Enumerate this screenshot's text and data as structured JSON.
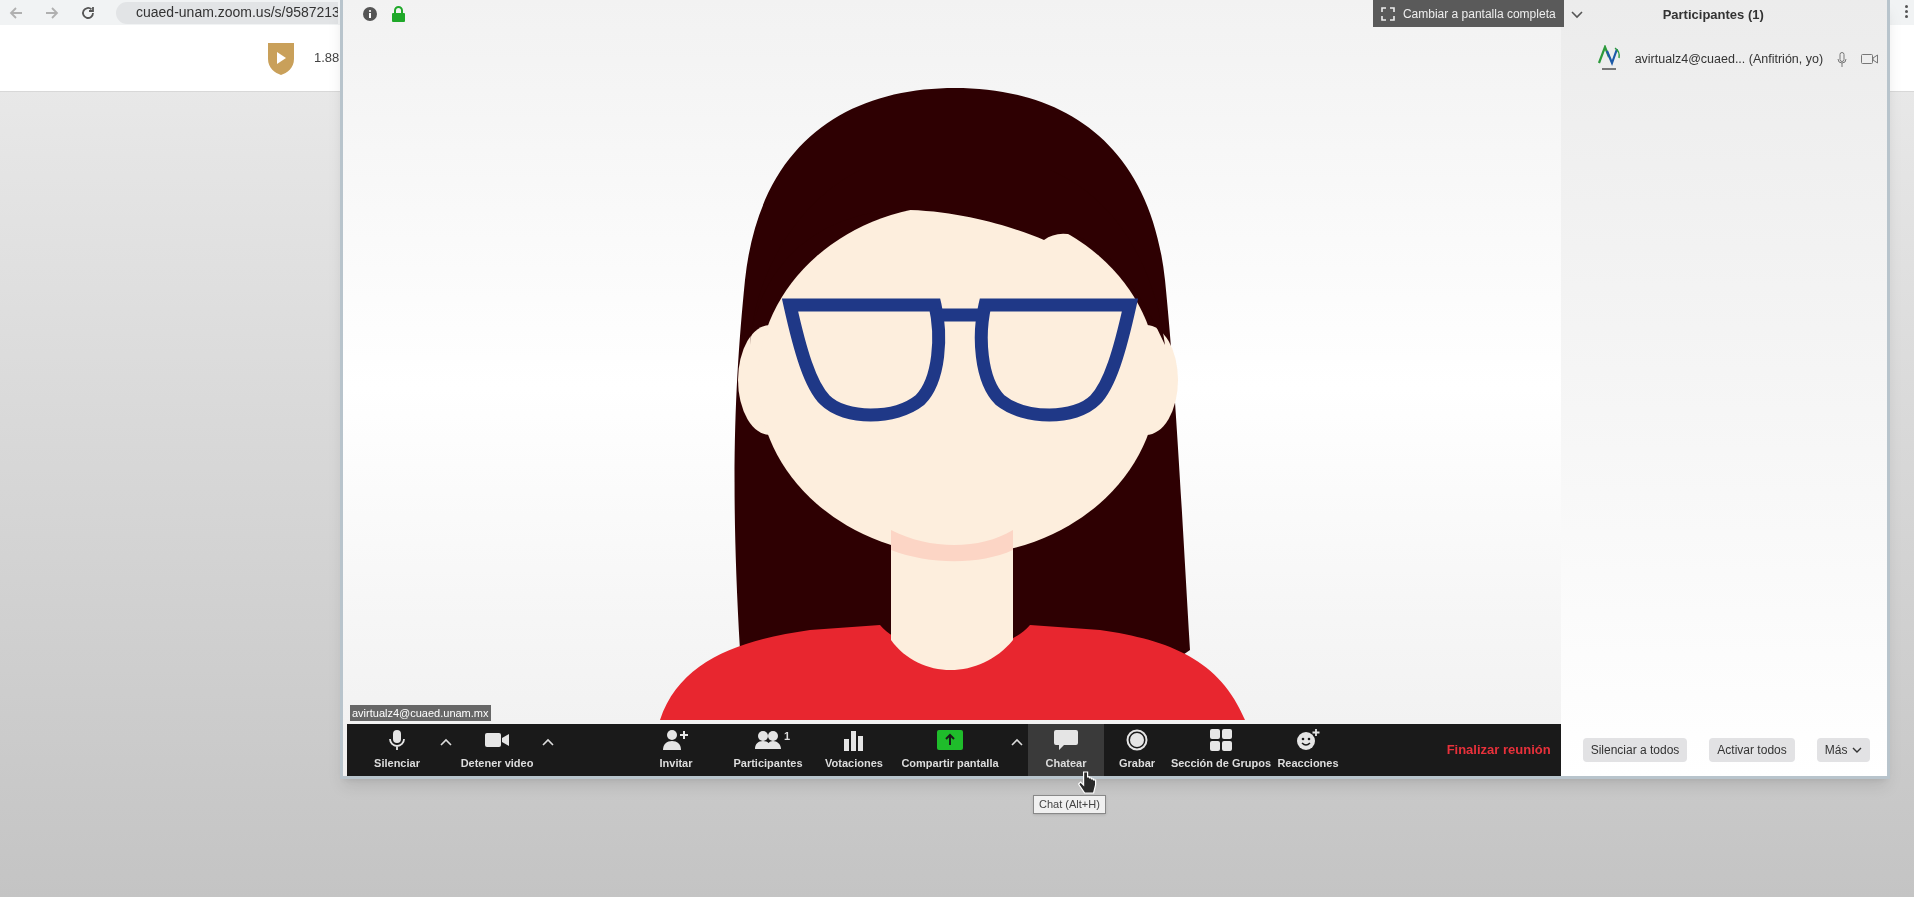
{
  "browser": {
    "url": "cuaed-unam.zoom.us/s/9587213",
    "page_text": "1.88"
  },
  "meeting": {
    "fullscreen_button": "Cambiar a pantalla completa",
    "name_label": "avirtualz4@cuaed.unam.mx",
    "toolbar": {
      "items": [
        {
          "kind": "mic",
          "label": "Silenciar",
          "caret": true,
          "hovered": false
        },
        {
          "kind": "video",
          "label": "Detener video",
          "caret": true,
          "hovered": false
        },
        {
          "kind": "invite",
          "label": "Invitar",
          "caret": false,
          "hovered": false
        },
        {
          "kind": "participants",
          "label": "Participantes",
          "badge": "1",
          "caret": false,
          "hovered": false
        },
        {
          "kind": "polls",
          "label": "Votaciones",
          "caret": false,
          "hovered": false
        },
        {
          "kind": "share",
          "label": "Compartir pantalla",
          "caret": true,
          "hovered": false
        },
        {
          "kind": "chat",
          "label": "Chatear",
          "caret": false,
          "hovered": true
        },
        {
          "kind": "record",
          "label": "Grabar",
          "caret": false,
          "hovered": false
        },
        {
          "kind": "breakout",
          "label": "Sección de Grupos",
          "caret": false,
          "hovered": false
        },
        {
          "kind": "reactions",
          "label": "Reacciones",
          "caret": false,
          "hovered": false
        }
      ],
      "end_button": "Finalizar reunión"
    },
    "tooltip": "Chat (Alt+H)",
    "participants_panel": {
      "title": "Participantes (1)",
      "participants": [
        {
          "name": "avirtualz4@cuaed... (Anfitrión, yo)"
        }
      ],
      "buttons": [
        "Silenciar a todos",
        "Activar todos",
        "Más"
      ]
    }
  }
}
